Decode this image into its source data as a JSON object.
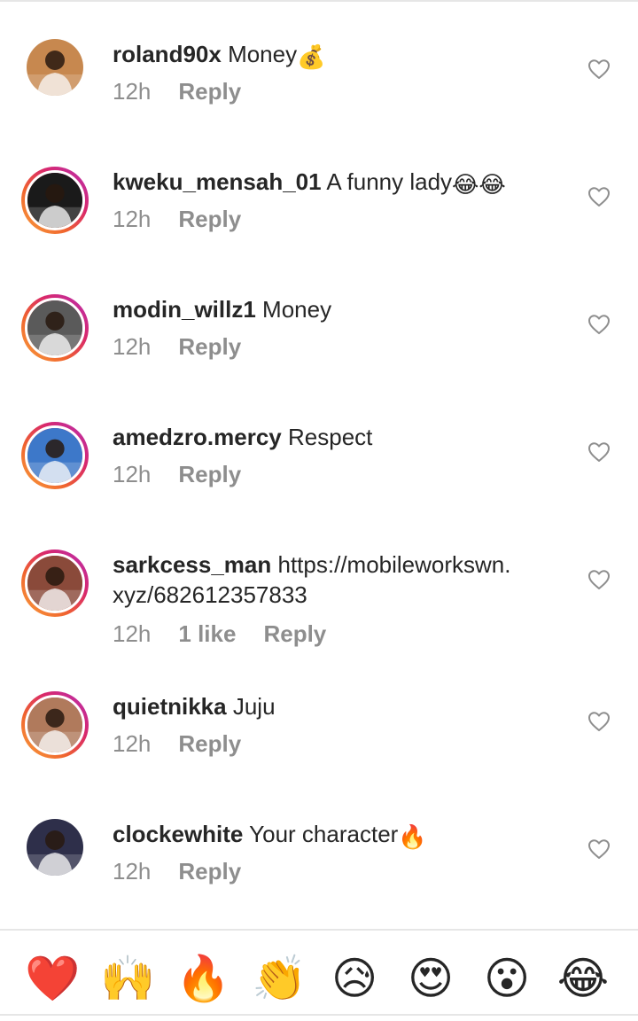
{
  "comments": [
    {
      "username": "roland90x",
      "text": "Money",
      "emoji": "💰",
      "time": "12h",
      "likes": "",
      "reply": "Reply",
      "ring": false,
      "avatar_color": "#c7884f"
    },
    {
      "username": "kweku_mensah_01",
      "text": "A funny lady",
      "emoji": "😂😂",
      "time": "12h",
      "likes": "",
      "reply": "Reply",
      "ring": true,
      "avatar_color": "#1a1a1a"
    },
    {
      "username": "modin_willz1",
      "text": "Money",
      "emoji": "",
      "time": "12h",
      "likes": "",
      "reply": "Reply",
      "ring": true,
      "avatar_color": "#5a5a5a"
    },
    {
      "username": "amedzro.mercy",
      "text": "Respect",
      "emoji": "",
      "time": "12h",
      "likes": "",
      "reply": "Reply",
      "ring": true,
      "avatar_color": "#3d78c9"
    },
    {
      "username": "sarkcess_man",
      "text": "https://mobileworkswn.\nxyz/682612357833",
      "emoji": "",
      "time": "12h",
      "likes": "1 like",
      "reply": "Reply",
      "ring": true,
      "avatar_color": "#8a4a3a"
    },
    {
      "username": "quietnikka",
      "text": "Juju",
      "emoji": "",
      "time": "12h",
      "likes": "",
      "reply": "Reply",
      "ring": true,
      "avatar_color": "#b07a5c"
    },
    {
      "username": "clockewhite",
      "text": "Your character",
      "emoji": "🔥",
      "time": "12h",
      "likes": "",
      "reply": "Reply",
      "ring": false,
      "avatar_color": "#2e2f4a"
    }
  ],
  "emoji_bar": [
    {
      "name": "red-heart",
      "glyph": "❤️"
    },
    {
      "name": "raising-hands",
      "glyph": "🙌"
    },
    {
      "name": "fire",
      "glyph": "🔥"
    },
    {
      "name": "clapping-hands",
      "glyph": "👏"
    },
    {
      "name": "sad-face",
      "glyph": "😥"
    },
    {
      "name": "heart-eyes",
      "glyph": "😍"
    },
    {
      "name": "surprised-face",
      "glyph": "😮"
    },
    {
      "name": "tears-of-joy",
      "glyph": "😂"
    }
  ],
  "colors": {
    "heart_stroke": "#8e8e8e",
    "meta": "#8e8e8e",
    "text": "#262626"
  }
}
